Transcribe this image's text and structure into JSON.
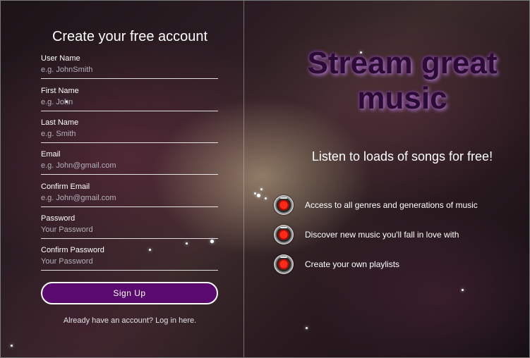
{
  "form": {
    "title": "Create your free account",
    "fields": [
      {
        "label": "User Name",
        "placeholder": "e.g. JohnSmith"
      },
      {
        "label": "First Name",
        "placeholder": "e.g. John"
      },
      {
        "label": "Last Name",
        "placeholder": "e.g. Smith"
      },
      {
        "label": "Email",
        "placeholder": "e.g. John@gmail.com"
      },
      {
        "label": "Confirm Email",
        "placeholder": "e.g. John@gmail.com"
      },
      {
        "label": "Password",
        "placeholder": "Your Password"
      },
      {
        "label": "Confirm Password",
        "placeholder": "Your Password"
      }
    ],
    "submit_label": "Sign Up",
    "login_text": "Already have an account? Log in here."
  },
  "promo": {
    "title": "Stream great music",
    "subtitle": "Listen to loads of songs for free!",
    "features": [
      {
        "icon": "record-icon",
        "text": "Access to all genres and generations of music"
      },
      {
        "icon": "record-icon",
        "text": "Discover new music you'll fall in love with"
      },
      {
        "icon": "record-icon",
        "text": "Create your own playlists"
      }
    ]
  },
  "colors": {
    "button_bg": "#5a0a6e",
    "promo_title": "#2a0b33",
    "icon_red": "#ff2a1a"
  }
}
